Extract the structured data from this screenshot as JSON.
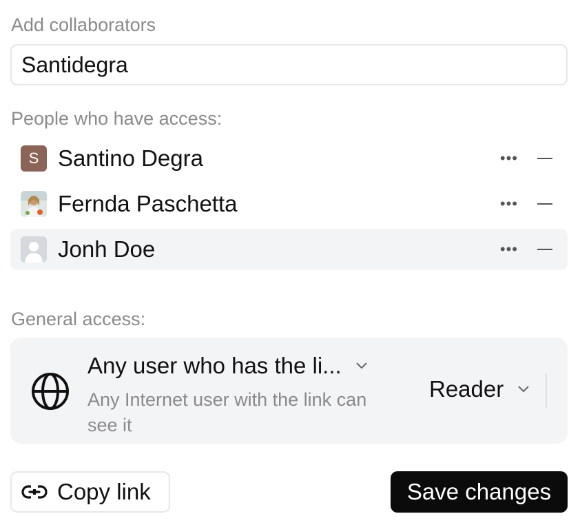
{
  "add_collaborators": {
    "label": "Add collaborators",
    "value": "Santidegra"
  },
  "people": {
    "label": "People who have access:",
    "list": [
      {
        "name": "Santino Degra",
        "avatar": "initial",
        "initial": "S"
      },
      {
        "name": "Fernda Paschetta",
        "avatar": "photo"
      },
      {
        "name": "Jonh Doe",
        "avatar": "placeholder"
      }
    ],
    "more_icon": "ellipsis-icon",
    "remove_icon": "minus-icon"
  },
  "general_access": {
    "label": "General access:",
    "title": "Any user who has the li...",
    "description": "Any Internet user with the link can see it",
    "role": "Reader",
    "icon": "globe-icon"
  },
  "footer": {
    "copy_label": "Copy link",
    "copy_icon": "link-icon",
    "save_label": "Save changes"
  },
  "colors": {
    "primary_button": "#0b0b0b",
    "muted_text": "#8a8a8a",
    "highlight_row": "#f3f4f6",
    "avatar_initial_bg": "#8b6458"
  }
}
